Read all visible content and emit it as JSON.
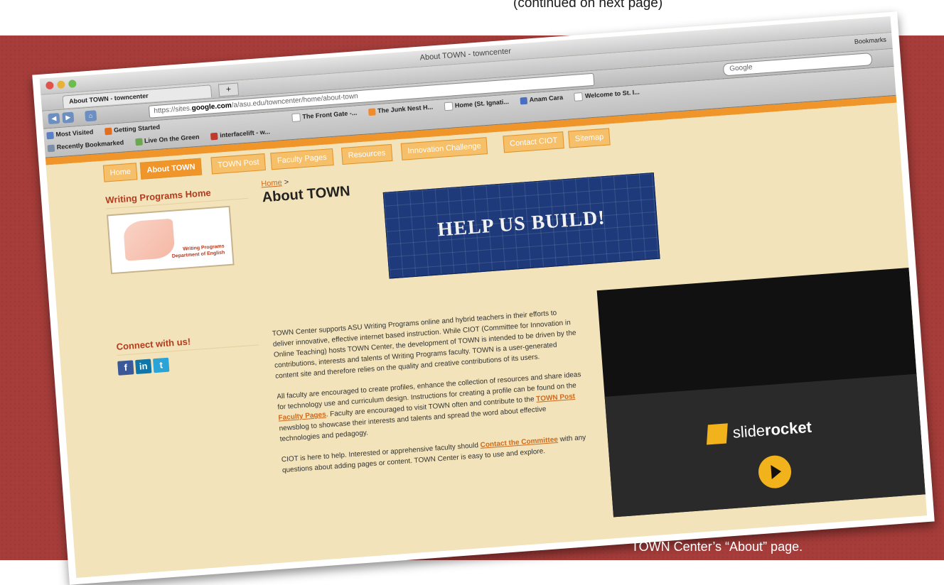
{
  "slide": {
    "continued_text": "(continued on next page)",
    "caption": "TOWN Center’s “About” page."
  },
  "browser": {
    "window_title": "About TOWN - towncenter",
    "tab_label": "About TOWN - towncenter",
    "new_tab": "+",
    "bookmarks_button": "Bookmarks",
    "url_prefix": "https://sites.",
    "url_domain": "google.com",
    "url_path": "/a/asu.edu/towncenter/home/about-town",
    "search_placeholder": "Google",
    "bookmarks_row1": [
      "Most Visited",
      "Getting Started",
      "The Front Gate -...",
      "The Junk Nest H...",
      "Home (St. Ignati...",
      "Anam Cara",
      "Welcome to St. I..."
    ],
    "bookmarks_row2": [
      "Recently Bookmarked",
      "Live On the Green",
      "interfacelift - w..."
    ]
  },
  "site": {
    "nav": [
      "Home",
      "About TOWN",
      "TOWN Post",
      "Faculty Pages",
      "Resources",
      "Innovation Challenge",
      "Contact CIOT",
      "Sitemap"
    ],
    "active_nav": "About TOWN",
    "sidebar": {
      "heading": "Writing Programs Home",
      "logo_text_1": "Writing Programs",
      "logo_text_2": "Department of English",
      "connect_heading": "Connect with us!",
      "social": [
        "f",
        "in",
        "t"
      ]
    },
    "breadcrumb_home": "Home",
    "breadcrumb_sep": ">",
    "title": "About TOWN",
    "banner_text": "HELP US BUILD!",
    "p1": "TOWN Center supports ASU Writing Programs online and hybrid teachers in their efforts to deliver innovative, effective internet based instruction. While CIOT (Committee for Innovation in Online Teaching) hosts TOWN Center, the development of TOWN is intended to be driven by the contributions, interests and talents of Writing Programs faculty. TOWN is a user-generated content site and therefore relies on the quality and creative contributions of its users.",
    "p2_a": "All faculty are encouraged to create profiles, enhance the collection of resources and share ideas for technology use and curriculum design. Instructions for creating a profile can be found on the ",
    "p2_link1": "Faculty Pages",
    "p2_b": ". Faculty are encouraged to visit TOWN often and contribute to the ",
    "p2_link2": "TOWN Post",
    "p2_c": " newsblog to showcase their interests and talents and spread the word about effective technologies and pedagogy.",
    "p3_a": "CIOT is here to help. Interested or apprehensive faculty should ",
    "p3_link": "Contact the Committee",
    "p3_b": " with any questions about adding pages or content. TOWN Center is easy to use and explore.",
    "video_brand_a": "slide",
    "video_brand_b": "rocket"
  }
}
